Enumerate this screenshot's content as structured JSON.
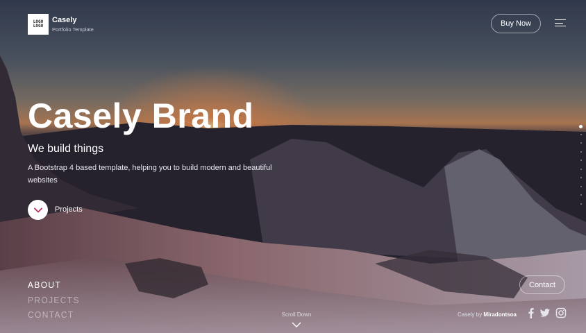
{
  "header": {
    "logo_text_1": "LOGO",
    "logo_text_2": "LOGO",
    "brand_name": "Casely",
    "brand_subtitle": "Portfolio Template",
    "buy_button": "Buy Now",
    "menu_icon": "hamburger-menu-icon"
  },
  "hero": {
    "title": "Casely Brand",
    "subtitle": "We build things",
    "description": "A Bootstrap 4 based template, helping you to build modern and beautiful websites",
    "projects_label": "Projects",
    "projects_icon": "chevron-down-icon"
  },
  "bottom_nav": [
    "ABOUT",
    "PROJECTS",
    "CONTACT"
  ],
  "scroll": {
    "label": "Scroll Down",
    "icon": "chevron-down-icon"
  },
  "footer": {
    "contact_button": "Contact",
    "credit_prefix": "Casely by",
    "credit_author": "Miradontsoa",
    "social_icons": [
      "facebook-icon",
      "twitter-icon",
      "instagram-icon"
    ]
  },
  "page_indicator": {
    "total": 10,
    "active_index": 0
  },
  "colors": {
    "accent": "#b5325a",
    "sky_top": "#3c4659",
    "sky_horizon": "#c3855a"
  }
}
